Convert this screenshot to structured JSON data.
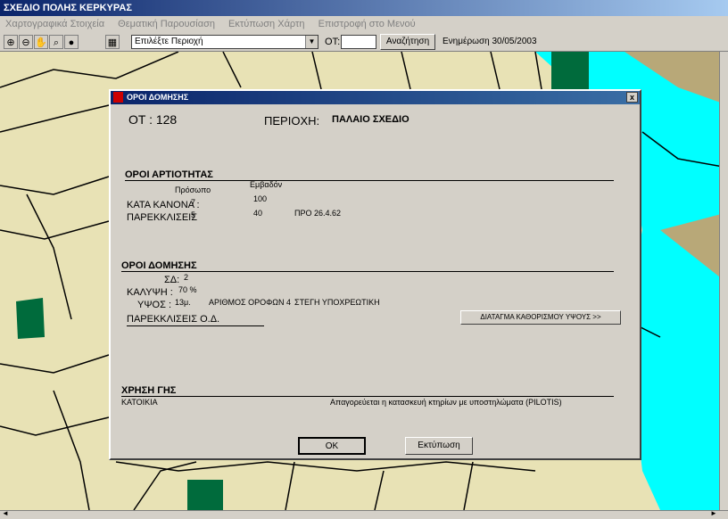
{
  "window": {
    "title": "ΣΧΕΔΙΟ ΠΟΛΗΣ ΚΕΡΚΥΡΑΣ"
  },
  "menu": [
    "Χαρτογραφικά Στοιχεία",
    "Θεματική Παρουσίαση",
    "Εκτύπωση Χάρτη",
    "Επιστροφή στο Μενού"
  ],
  "toolbar": {
    "area_select": "Επιλέξτε Περιοχή",
    "ot_label": "ΟΤ:",
    "ot_value": "",
    "search_label": "Αναζήτηση",
    "update_text": "Ενημέρωση 30/05/2003"
  },
  "dialog": {
    "title": "ΟΡΟΙ ΔΟΜΗΣΗΣ",
    "ot": "ΟΤ : 128",
    "area_label": "ΠΕΡΙΟΧΗ:",
    "area_value": "ΠΑΛΑΙΟ ΣΧΕΔΙΟ",
    "artiotita": {
      "heading": "ΟΡΟΙ ΑΡΤΙΟΤΗΤΑΣ",
      "col_front": "Πρόσωπο",
      "col_area": "Εμβαδόν",
      "rule_label": "ΚΑΤΑ ΚΑΝΟΝΑ :",
      "rule_front": "7",
      "rule_area": "100",
      "exc_label": "ΠΑΡΕΚΚΛΙΣΕΙΣ",
      "exc_front": "5",
      "exc_area": "40",
      "exc_note": "ΠΡΟ 26.4.62"
    },
    "domisi": {
      "heading": "ΟΡΟΙ ΔΟΜΗΣΗΣ",
      "sd_label": "ΣΔ:",
      "sd_value": "2",
      "cover_label": "ΚΑΛΥΨΗ :",
      "cover_value": "70 %",
      "height_label": "ΥΨΟΣ :",
      "height_value": "13μ.",
      "floors": "ΑΡΙΘΜΟΣ ΟΡΟΦΩΝ 4",
      "roof": "ΣΤΕΓΗ ΥΠΟΧΡΕΩΤΙΚΗ",
      "exc_od": "ΠΑΡΕΚΚΛΙΣΕΙΣ Ο.Δ.",
      "height_decree_button": "ΔΙΑΤΑΓΜΑ ΚΑΘΟΡΙΣΜΟΥ ΥΨΟΥΣ >>"
    },
    "landuse": {
      "heading": "ΧΡΗΣΗ ΓΗΣ",
      "value": "ΚΑΤΟΙΚΙΑ",
      "note": "Απαγορεύεται η κατασκευή κτηρίων με υποστηλώματα (PILOTIS)"
    },
    "ok_label": "OK",
    "print_label": "Εκτύπωση",
    "close_glyph": "x"
  },
  "colors": {
    "map_bg": "#e8e2b5",
    "sea": "#00ffff",
    "green": "#006b3c",
    "land": "#b8a878"
  }
}
